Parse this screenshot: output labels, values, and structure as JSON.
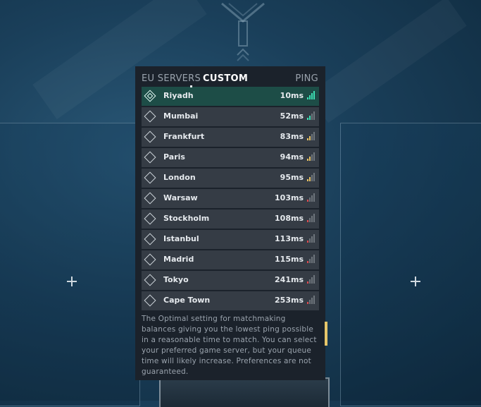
{
  "tabs": {
    "eu": "EU SERVERS",
    "custom": "CUSTOM",
    "ping": "PING"
  },
  "colors": {
    "good": "#3de0b4",
    "medium": "#e7c164",
    "bad": "#e04a4f",
    "inactive": "#6e757c"
  },
  "servers": [
    {
      "name": "Riyadh",
      "ping": "10ms",
      "bars": 4,
      "quality": "good",
      "selected": true
    },
    {
      "name": "Mumbai",
      "ping": "52ms",
      "bars": 2,
      "quality": "good",
      "selected": false
    },
    {
      "name": "Frankfurt",
      "ping": "83ms",
      "bars": 2,
      "quality": "medium",
      "selected": false
    },
    {
      "name": "Paris",
      "ping": "94ms",
      "bars": 2,
      "quality": "medium",
      "selected": false
    },
    {
      "name": "London",
      "ping": "95ms",
      "bars": 2,
      "quality": "medium",
      "selected": false
    },
    {
      "name": "Warsaw",
      "ping": "103ms",
      "bars": 1,
      "quality": "bad",
      "selected": false
    },
    {
      "name": "Stockholm",
      "ping": "108ms",
      "bars": 1,
      "quality": "bad",
      "selected": false
    },
    {
      "name": "Istanbul",
      "ping": "113ms",
      "bars": 1,
      "quality": "bad",
      "selected": false
    },
    {
      "name": "Madrid",
      "ping": "115ms",
      "bars": 1,
      "quality": "bad",
      "selected": false
    },
    {
      "name": "Tokyo",
      "ping": "241ms",
      "bars": 1,
      "quality": "bad",
      "selected": false
    },
    {
      "name": "Cape Town",
      "ping": "253ms",
      "bars": 1,
      "quality": "bad",
      "selected": false
    }
  ],
  "description": "The Optimal setting for matchmaking balances giving you the lowest ping possible in a reasonable time to match. You can select your preferred game server, but your queue time will likely increase. Preferences are not guaranteed."
}
